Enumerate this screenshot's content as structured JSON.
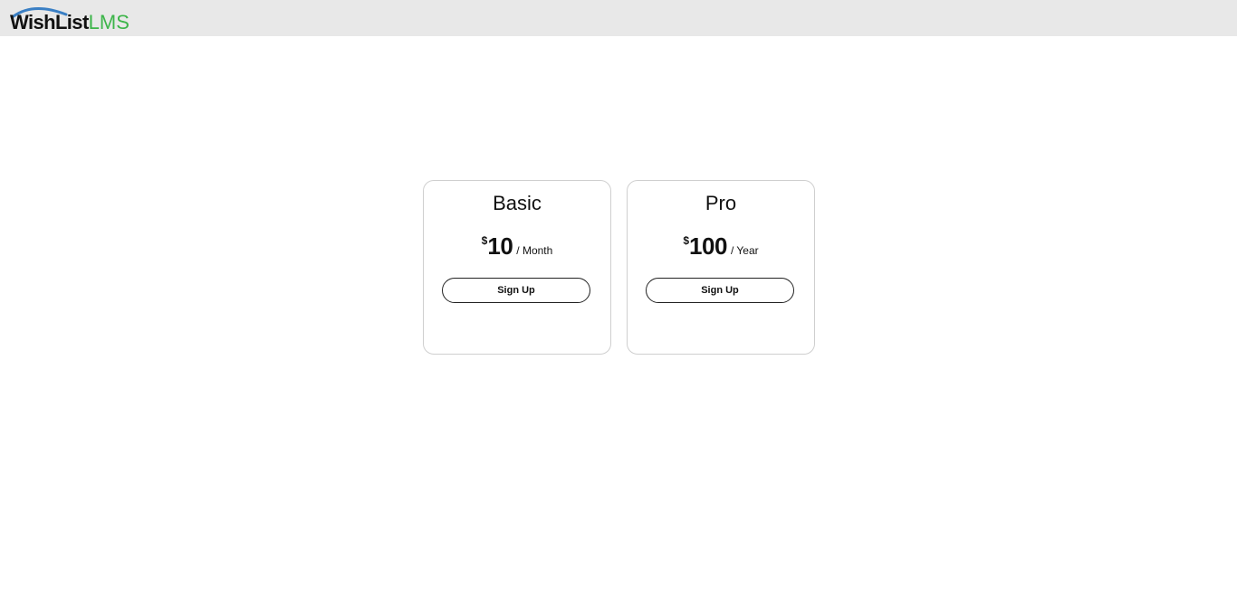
{
  "header": {
    "logo_wish": "WishList",
    "logo_lms": "LMS",
    "logo_arc_color": "#3a7fc4",
    "logo_lms_color": "#3db54a",
    "background": "#e8e8e8"
  },
  "plans": [
    {
      "name": "Basic",
      "currency": "$",
      "amount": "10",
      "period": "/ Month",
      "button_label": "Sign Up"
    },
    {
      "name": "Pro",
      "currency": "$",
      "amount": "100",
      "period": "/ Year",
      "button_label": "Sign Up"
    }
  ]
}
